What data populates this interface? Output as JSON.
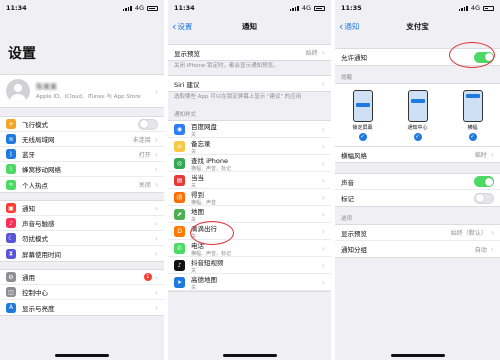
{
  "panel1": {
    "status": {
      "time": "11:34",
      "network": "4G"
    },
    "title": "设置",
    "profile": {
      "name": "陈某某",
      "subtitle": "Apple ID、iCloud、iTunes 与 App Store"
    },
    "group1": [
      {
        "label": "飞行模式",
        "icon": "airplane-icon",
        "color": "#f5a623",
        "glyph": "✈",
        "type": "toggle",
        "on": false
      },
      {
        "label": "无线局域网",
        "icon": "wifi-icon",
        "color": "#1f7ae0",
        "glyph": "≋",
        "value": "未连接"
      },
      {
        "label": "蓝牙",
        "icon": "bluetooth-icon",
        "color": "#1f7ae0",
        "glyph": "ᛒ",
        "value": "打开"
      },
      {
        "label": "蜂窝移动网络",
        "icon": "cellular-icon",
        "color": "#4cd964",
        "glyph": "⌇",
        "value": ""
      },
      {
        "label": "个人热点",
        "icon": "hotspot-icon",
        "color": "#4cd964",
        "glyph": "∞",
        "value": "关闭"
      }
    ],
    "group2": [
      {
        "label": "通知",
        "icon": "notifications-icon",
        "color": "#ff3b30",
        "glyph": "▣",
        "value": ""
      },
      {
        "label": "声音与触感",
        "icon": "sounds-icon",
        "color": "#ff2d55",
        "glyph": "♪",
        "value": ""
      },
      {
        "label": "勿扰模式",
        "icon": "do-not-disturb-icon",
        "color": "#5856d6",
        "glyph": "☾",
        "value": ""
      },
      {
        "label": "屏幕使用时间",
        "icon": "screen-time-icon",
        "color": "#5856d6",
        "glyph": "⧗",
        "value": ""
      }
    ],
    "group3": [
      {
        "label": "通用",
        "icon": "general-icon",
        "color": "#8e8e93",
        "glyph": "⚙",
        "badge": "1"
      },
      {
        "label": "控制中心",
        "icon": "control-center-icon",
        "color": "#8e8e93",
        "glyph": "◫"
      },
      {
        "label": "显示与亮度",
        "icon": "display-icon",
        "color": "#1f7ae0",
        "glyph": "A"
      }
    ]
  },
  "panel2": {
    "status": {
      "time": "11:34",
      "network": "4G"
    },
    "back": "设置",
    "title": "通知",
    "preview_label": "显示预览",
    "preview_value": "始终",
    "preview_note": "关闭 iPhone 锁定时，都会显示通知预览。",
    "siri_label": "Siri 建议",
    "siri_note": "选取哪些 App 可以在锁定屏幕上显示 \"建议\" 的应用",
    "section_title": "通知样式",
    "apps": [
      {
        "name": "百度网盘",
        "sub": "关",
        "color": "#2f7cf6",
        "glyph": "◉",
        "icon": "baidu-netdisk-icon"
      },
      {
        "name": "备忘录",
        "sub": "关",
        "color": "#f7c843",
        "glyph": "≡",
        "icon": "notes-icon"
      },
      {
        "name": "查找 iPhone",
        "sub": "横幅、声音、标记",
        "color": "#34a853",
        "glyph": "◎",
        "icon": "find-iphone-icon"
      },
      {
        "name": "当当",
        "sub": "关",
        "color": "#e53935",
        "glyph": "▤",
        "icon": "dangdang-icon"
      },
      {
        "name": "得到",
        "sub": "横幅、声音",
        "color": "#ff6d00",
        "glyph": "得",
        "icon": "dedao-icon"
      },
      {
        "name": "地图",
        "sub": "关",
        "color": "#4caf50",
        "glyph": "⬈",
        "icon": "maps-icon"
      },
      {
        "name": "滴滴出行",
        "sub": "关",
        "color": "#ff7a00",
        "glyph": "D",
        "icon": "didi-icon"
      },
      {
        "name": "电话",
        "sub": "横幅、声音、标记",
        "color": "#4cd964",
        "glyph": "✆",
        "icon": "phone-icon"
      },
      {
        "name": "抖音短视频",
        "sub": "关",
        "color": "#111111",
        "glyph": "♪",
        "icon": "douyin-icon"
      },
      {
        "name": "高德地图",
        "sub": "关",
        "color": "#1f7ae0",
        "glyph": "➤",
        "icon": "amap-icon"
      }
    ]
  },
  "panel3": {
    "status": {
      "time": "11:35",
      "network": "4G"
    },
    "back": "通知",
    "title": "支付宝",
    "allow_label": "允许通知",
    "alerts_title": "提醒",
    "styles": [
      {
        "caption": "锁定屏幕"
      },
      {
        "caption": "通知中心"
      },
      {
        "caption": "横幅"
      }
    ],
    "banner_style_label": "横幅风格",
    "banner_style_value": "临时",
    "sound_label": "声音",
    "badge_label": "标记",
    "options_title": "选项",
    "show_preview_label": "显示预览",
    "show_preview_value": "始终（默认）",
    "grouping_label": "通知分组",
    "grouping_value": "自动"
  }
}
